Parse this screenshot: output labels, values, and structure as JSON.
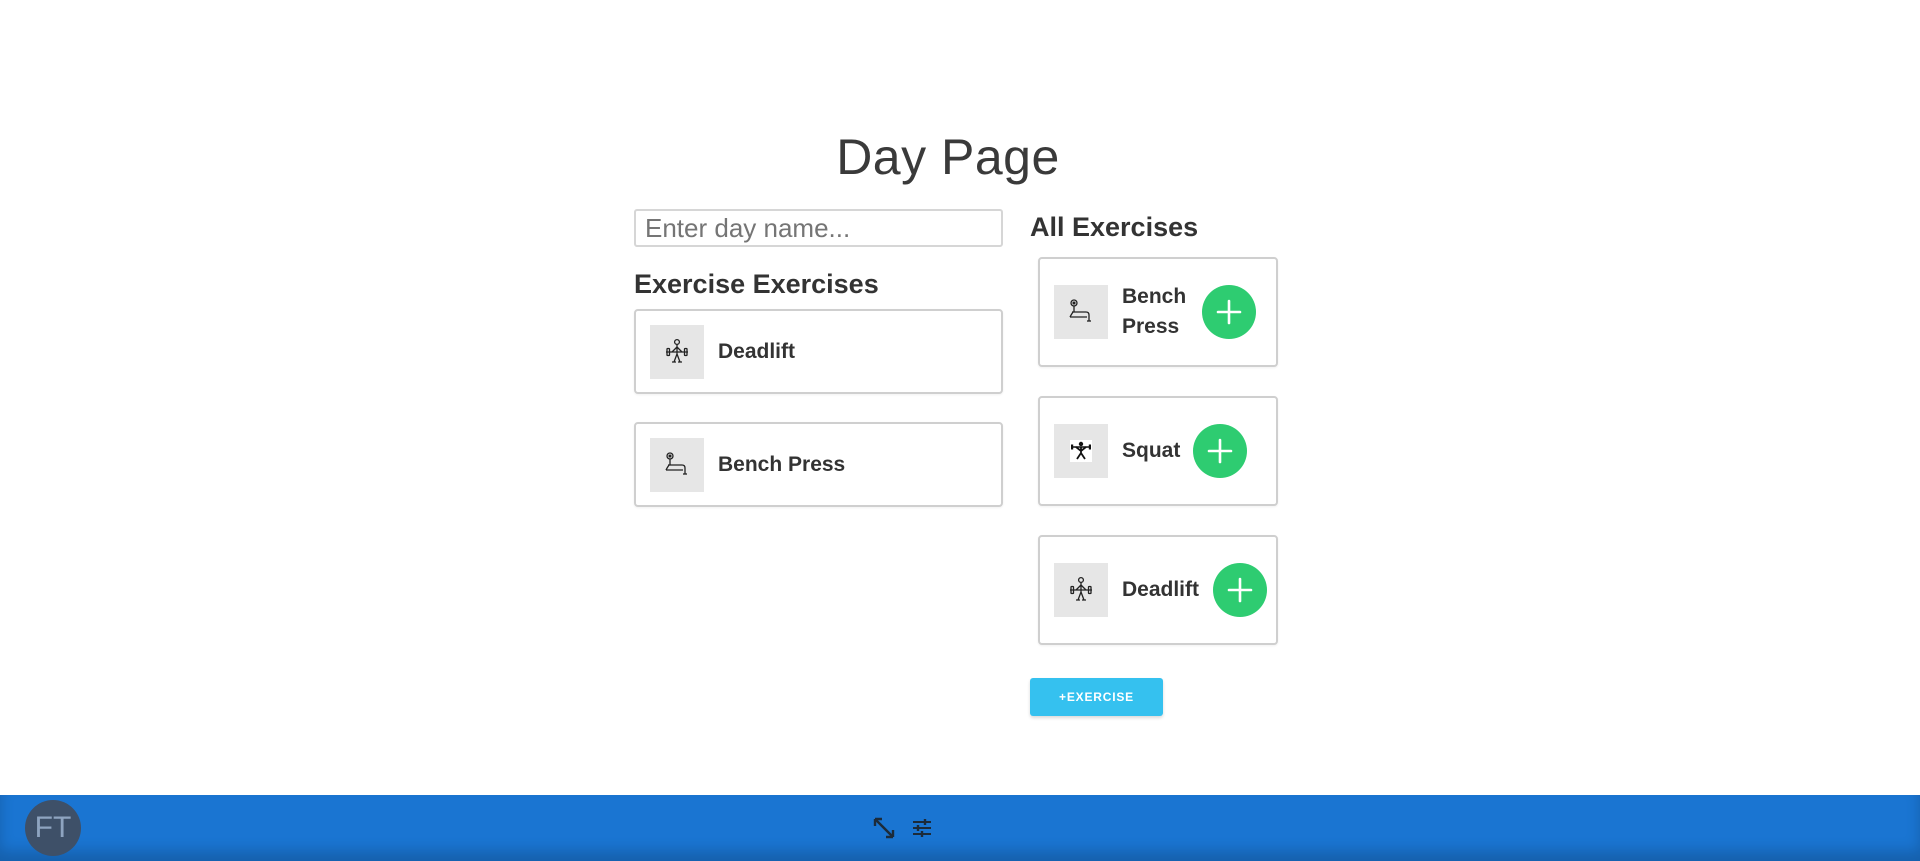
{
  "page": {
    "title": "Day Page"
  },
  "day_form": {
    "name_value": "",
    "name_placeholder": "Enter day name..."
  },
  "day_exercises": {
    "heading": "Exercise Exercises",
    "items": [
      {
        "name": "Deadlift",
        "icon": "deadlift-icon"
      },
      {
        "name": "Bench Press",
        "icon": "bench-press-icon"
      }
    ]
  },
  "all_exercises": {
    "heading": "All Exercises",
    "items": [
      {
        "name": "Bench Press",
        "icon": "bench-press-icon"
      },
      {
        "name": "Squat",
        "icon": "squat-icon"
      },
      {
        "name": "Deadlift",
        "icon": "deadlift-icon"
      }
    ],
    "add_icon": "plus-icon",
    "add_exercise_label": "+EXERCISE"
  },
  "bottom_bar": {
    "avatar_initials": "FT",
    "icons": [
      "expand-icon",
      "tune-icon"
    ]
  },
  "colors": {
    "accent_green": "#2ecc71",
    "button_blue": "#35c1ef",
    "bar_blue": "#1a75d2"
  }
}
